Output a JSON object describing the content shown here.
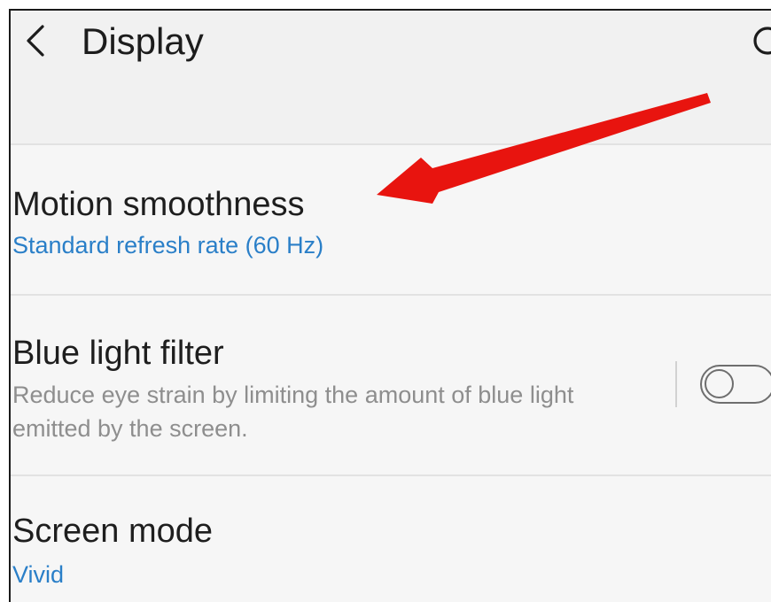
{
  "header": {
    "title": "Display",
    "back_icon": "back-arrow-icon",
    "search_icon": "search-icon"
  },
  "settings": [
    {
      "title": "Motion smoothness",
      "subtitle": "Standard refresh rate (60 Hz)"
    },
    {
      "title": "Blue light filter",
      "description": "Reduce eye strain by limiting the amount of blue light emitted by the screen.",
      "toggle_on": false
    },
    {
      "title": "Screen mode",
      "subtitle": "Vivid"
    }
  ],
  "colors": {
    "accent": "#2a7fc8",
    "annotation_arrow": "#e8140f",
    "background": "#f6f6f6",
    "header_background": "#f1f1f1"
  }
}
